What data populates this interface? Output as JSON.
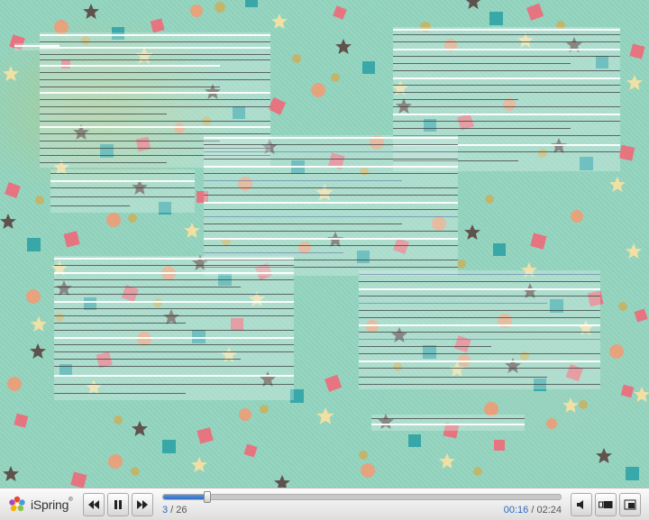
{
  "player": {
    "logo_text": "iSpring",
    "logo_mark": "®",
    "slide_current": "3",
    "slide_sep": " / ",
    "slide_total": "26",
    "time_current": "00:16",
    "time_sep": " / ",
    "time_total": "02:24",
    "progress_fraction": 0.11
  },
  "icons": {
    "prev": "rewind-icon",
    "pause": "pause-icon",
    "next": "fast-forward-icon",
    "volume": "volume-icon",
    "layout": "layout-icon",
    "fullscreen": "fullscreen-icon"
  },
  "colors": {
    "slide_background": "#92d4bf",
    "progress_fill": "#2f6cc2",
    "accent_text": "#2a6abf",
    "confetti_red": "#ef6b7a",
    "confetti_teal": "#2fa3a6",
    "confetti_orange": "#f39a72",
    "confetti_gold": "#c9b15d",
    "confetti_star_light": "#f6e1a2",
    "confetti_star_dark": "#5a4340"
  }
}
